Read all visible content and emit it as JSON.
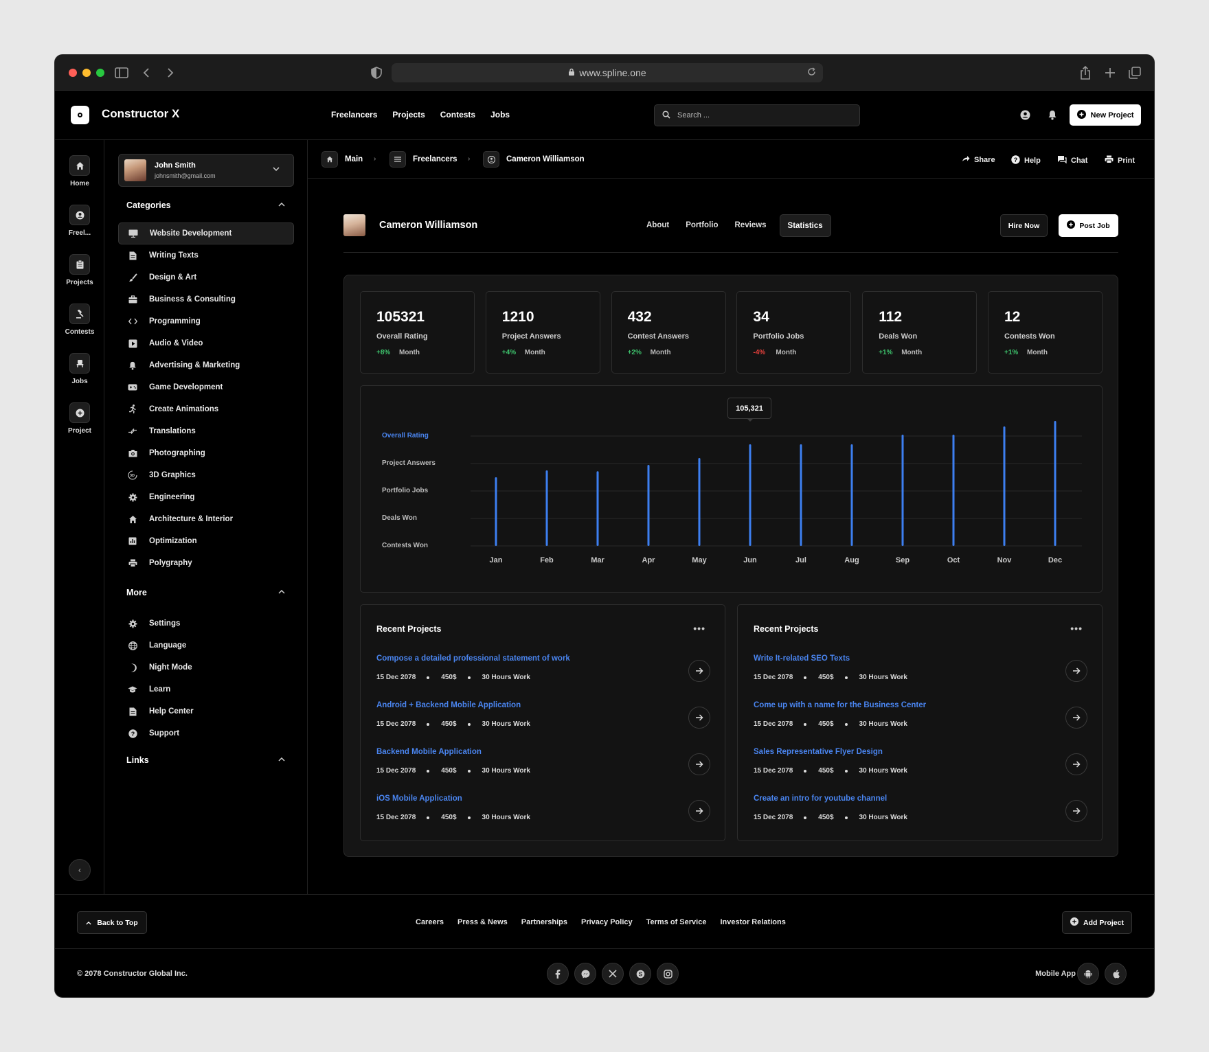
{
  "browser": {
    "url": "www.spline.one",
    "traffic_lights": [
      "#fe5f57",
      "#febc2e",
      "#28c840"
    ]
  },
  "topnav": {
    "brand": "Constructor X",
    "links": [
      "Freelancers",
      "Projects",
      "Contests",
      "Jobs"
    ],
    "search_placeholder": "Search ...",
    "new_project": "New Project"
  },
  "rail": [
    {
      "label": "Home",
      "icon": "home-icon"
    },
    {
      "label": "Freel...",
      "icon": "user-circle-icon"
    },
    {
      "label": "Projects",
      "icon": "clipboard-icon"
    },
    {
      "label": "Contests",
      "icon": "gavel-icon"
    },
    {
      "label": "Jobs",
      "icon": "chair-icon"
    },
    {
      "label": "Project",
      "icon": "plus-circle-icon"
    }
  ],
  "user": {
    "name": "John Smith",
    "email": "johnsmith@gmail.com"
  },
  "sidebar": {
    "categories_title": "Categories",
    "categories": [
      {
        "label": "Website Development",
        "icon": "monitor-icon"
      },
      {
        "label": "Writing Texts",
        "icon": "document-icon"
      },
      {
        "label": "Design & Art",
        "icon": "brush-icon"
      },
      {
        "label": "Business & Consulting",
        "icon": "briefcase-icon"
      },
      {
        "label": "Programming",
        "icon": "code-icon"
      },
      {
        "label": "Audio & Video",
        "icon": "play-icon"
      },
      {
        "label": "Advertising & Marketing",
        "icon": "bell-icon"
      },
      {
        "label": "Game Development",
        "icon": "gamepad-icon"
      },
      {
        "label": "Create Animations",
        "icon": "running-icon"
      },
      {
        "label": "Translations",
        "icon": "translate-icon"
      },
      {
        "label": "Photographing",
        "icon": "camera-icon"
      },
      {
        "label": "3D Graphics",
        "icon": "3d-icon"
      },
      {
        "label": "Engineering",
        "icon": "gear-icon"
      },
      {
        "label": "Architecture & Interior",
        "icon": "house-icon"
      },
      {
        "label": "Optimization",
        "icon": "chart-icon"
      },
      {
        "label": "Polygraphy",
        "icon": "printer-icon"
      }
    ],
    "more_title": "More",
    "more": [
      {
        "label": "Settings",
        "icon": "gear-icon"
      },
      {
        "label": "Language",
        "icon": "globe-icon"
      },
      {
        "label": "Night Mode",
        "icon": "moon-icon"
      },
      {
        "label": "Learn",
        "icon": "graduation-icon"
      },
      {
        "label": "Help Center",
        "icon": "document-icon"
      },
      {
        "label": "Support",
        "icon": "question-icon"
      }
    ],
    "links_title": "Links"
  },
  "breadcrumb": [
    "Main",
    "Freelancers",
    "Cameron Williamson"
  ],
  "actions": [
    "Share",
    "Help",
    "Chat",
    "Print"
  ],
  "profile": {
    "name": "Cameron Williamson",
    "tabs": [
      "About",
      "Portfolio",
      "Reviews",
      "Statistics"
    ],
    "hire_now": "Hire Now",
    "post_job": "Post Job"
  },
  "stats": [
    {
      "value": "105321",
      "label": "Overall Rating",
      "delta": "+8%",
      "period": "Month"
    },
    {
      "value": "1210",
      "label": "Project Answers",
      "delta": "+4%",
      "period": "Month"
    },
    {
      "value": "432",
      "label": "Contest Answers",
      "delta": "+2%",
      "period": "Month"
    },
    {
      "value": "34",
      "label": "Portfolio Jobs",
      "delta": "-4%",
      "period": "Month"
    },
    {
      "value": "112",
      "label": "Deals Won",
      "delta": "+1%",
      "period": "Month"
    },
    {
      "value": "12",
      "label": "Contests Won",
      "delta": "+1%",
      "period": "Month"
    }
  ],
  "chart_data": {
    "type": "bar",
    "categories": [
      "Jan",
      "Feb",
      "Mar",
      "Apr",
      "May",
      "Jun",
      "Jul",
      "Aug",
      "Sep",
      "Oct",
      "Nov",
      "Dec"
    ],
    "series_labels": [
      "Overall Rating",
      "Project Answers",
      "Portfolio Jobs",
      "Deals Won",
      "Contests Won"
    ],
    "selected_series": "Overall Rating",
    "values": [
      2.5,
      2.75,
      2.72,
      2.95,
      3.2,
      3.7,
      3.7,
      3.7,
      4.05,
      4.05,
      4.35,
      4.55
    ],
    "ylim": [
      0,
      4
    ],
    "tooltip": {
      "month": "Jun",
      "text": "105,321"
    },
    "bar_color": "#3d7ff0",
    "grid": true
  },
  "recent": [
    {
      "title": "Recent Projects",
      "items": [
        {
          "title": "Compose a detailed professional statement of work",
          "date": "15 Dec 2078",
          "price": "450$",
          "hours": "30 Hours Work"
        },
        {
          "title": "Android + Backend Mobile Application",
          "date": "15 Dec 2078",
          "price": "450$",
          "hours": "30 Hours Work"
        },
        {
          "title": "Backend Mobile Application",
          "date": "15 Dec 2078",
          "price": "450$",
          "hours": "30 Hours Work"
        },
        {
          "title": "iOS Mobile Application",
          "date": "15 Dec 2078",
          "price": "450$",
          "hours": "30 Hours Work"
        }
      ]
    },
    {
      "title": "Recent Projects",
      "items": [
        {
          "title": "Write It-related SEO Texts",
          "date": "15 Dec 2078",
          "price": "450$",
          "hours": "30 Hours Work"
        },
        {
          "title": "Come up with a name for the Business Center",
          "date": "15 Dec 2078",
          "price": "450$",
          "hours": "30 Hours Work"
        },
        {
          "title": "Sales Representative Flyer Design",
          "date": "15 Dec 2078",
          "price": "450$",
          "hours": "30 Hours Work"
        },
        {
          "title": "Create an intro for youtube channel",
          "date": "15 Dec 2078",
          "price": "450$",
          "hours": "30 Hours Work"
        }
      ]
    }
  ],
  "footer": {
    "back_to_top": "Back to Top",
    "links": [
      "Careers",
      "Press & News",
      "Partnerships",
      "Privacy Policy",
      "Terms of Service",
      "Investor Relations"
    ],
    "add_project": "Add Project",
    "copyright": "© 2078 Constructor Global Inc.",
    "social": [
      "facebook-icon",
      "messenger-icon",
      "x-icon",
      "skype-icon",
      "instagram-icon"
    ],
    "mobile_label": "Mobile App",
    "mobile": [
      "android-icon",
      "apple-icon"
    ]
  }
}
